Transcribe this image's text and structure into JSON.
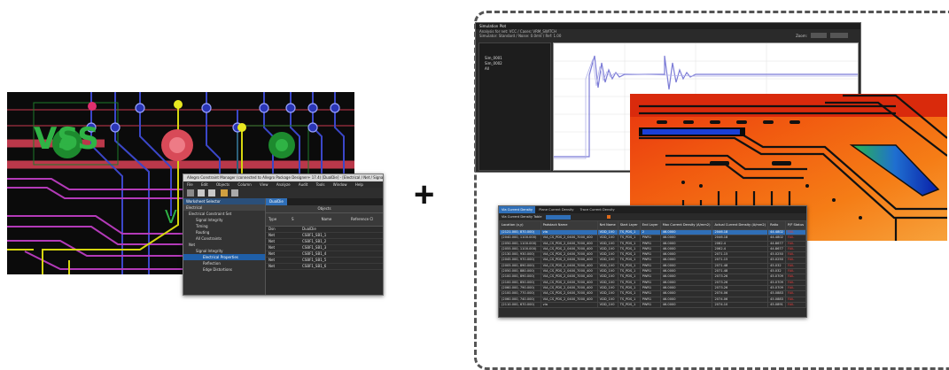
{
  "pcb": {
    "label_vss": "VSS",
    "label_v": "V"
  },
  "constraint_manager": {
    "title": "Allegro Constraint Manager (connected to Allegro Package Designer+ 17.4) [DualDie] - [Electrical / Net / Signal Integrity]",
    "menu": [
      "File",
      "Edit",
      "Objects",
      "Column",
      "View",
      "Analyze",
      "Audit",
      "Tools",
      "Window",
      "Help"
    ],
    "worksheet_selector_label": "Worksheet Selector",
    "section_label": "Electrical",
    "tree": [
      {
        "label": "Electrical Constraint Set",
        "level": 0
      },
      {
        "label": "Signal Integrity",
        "level": 1
      },
      {
        "label": "Timing",
        "level": 1
      },
      {
        "label": "Routing",
        "level": 1
      },
      {
        "label": "All Constraints",
        "level": 1
      },
      {
        "label": "Net",
        "level": 0
      },
      {
        "label": "Signal Integrity",
        "level": 1
      },
      {
        "label": "Electrical Properties",
        "level": 2,
        "selected": true
      },
      {
        "label": "Reflection",
        "level": 2
      },
      {
        "label": "Edge Distortions",
        "level": 2
      }
    ],
    "grid_tab": "DualDie",
    "objects_header": "Objects",
    "col_type": "Type",
    "col_s": "S",
    "col_name": "Name",
    "col_ref": "Reference Cl",
    "rows": [
      {
        "type": "Dsn",
        "name": "DualDie"
      },
      {
        "type": "Net",
        "name": "CSBF1_SB1_1"
      },
      {
        "type": "Net",
        "name": "CSBF1_SB1_2"
      },
      {
        "type": "Net",
        "name": "CSBF1_SB1_3"
      },
      {
        "type": "Net",
        "name": "CSBF1_SB1_4"
      },
      {
        "type": "Net",
        "name": "CSBF1_SB1_5"
      },
      {
        "type": "Net",
        "name": "CSBF1_SB1_6"
      }
    ]
  },
  "plus": "+",
  "simulation_plot": {
    "title": "Simulation Plot",
    "header_line1": "Analysis for net: VCC / Cases: VRM_SWITCH",
    "header_line2": "Simulator: Standard / Noise: 0.0mV / Ref: 1.00",
    "zoom_label": "Zoom:",
    "tree_items": [
      "Sim_0001",
      "Sim_0002",
      "All"
    ],
    "waveform_color": "#7b7bd6"
  },
  "current_density": {
    "tabs": [
      "Via Current Density",
      "Plane Current Density",
      "Trace Current Density"
    ],
    "filter_label": "Via Current Density Table",
    "headers": [
      "Location (x,y)",
      "Padstack Name",
      "Net Name",
      "Start Layer",
      "End Layer",
      "Max Current Density (A/mm2)",
      "Actual Current Density (A/mm2)",
      "Ratio",
      "P/F Status"
    ],
    "rows": [
      [
        "(2121.000, 870.000)",
        "via",
        "VDD_1V0",
        "TS_PDS_1",
        "2",
        "46.0000",
        "2046.18",
        "44.4802",
        "FAIL"
      ],
      [
        "(2040.000, 1100.000)",
        "VIA_CS_PDS_2_0400_7000_400",
        "VDD_1V0",
        "TS_PDS_1",
        "PWR1",
        "46.0000",
        "2046.18",
        "44.4802",
        "FAIL"
      ],
      [
        "(2050.000, 1100.000)",
        "VIA_CS_PDS_2_0400_7000_400",
        "VDD_1V0",
        "TS_PDS_1",
        "PWR1",
        "46.0000",
        "2062.4",
        "44.8677",
        "FAIL"
      ],
      [
        "(2055.000, 1100.000)",
        "VIA_CS_PDS_2_0400_7000_400",
        "VDD_1V0",
        "TS_PDS_1",
        "PWR1",
        "46.0000",
        "2062.4",
        "44.8677",
        "FAIL"
      ],
      [
        "(2130.000, 930.000)",
        "VIA_CS_PDS_2_0400_7000_400",
        "VDD_1V0",
        "TS_PDS_1",
        "PWR1",
        "46.0000",
        "2071.15",
        "45.0250",
        "FAIL"
      ],
      [
        "(2045.000, 970.000)",
        "VIA_CS_PDS_2_0400_7000_400",
        "VDD_1V0",
        "TS_PDS_1",
        "PWR1",
        "46.0000",
        "2071.15",
        "45.0250",
        "FAIL"
      ],
      [
        "(2005.000, 890.000)",
        "VIA_CS_PDS_2_0400_7000_400",
        "VDD_1V0",
        "TS_PDS_1",
        "PWR1",
        "46.0000",
        "2071.48",
        "45.032",
        "FAIL"
      ],
      [
        "(2050.000, 880.000)",
        "VIA_CS_PDS_2_0400_7000_400",
        "VDD_1V0",
        "TS_PDS_1",
        "PWR1",
        "46.0000",
        "2071.48",
        "45.032",
        "FAIL"
      ],
      [
        "(2100.000, 890.000)",
        "VIA_CS_PDS_2_0400_7000_400",
        "VDD_1V0",
        "TS_PDS_1",
        "PWR1",
        "46.0000",
        "2073.26",
        "45.0709",
        "FAIL"
      ],
      [
        "(2100.000, 850.000)",
        "VIA_CS_PDS_2_0400_7000_400",
        "VDD_1V0",
        "TS_PDS_1",
        "PWR1",
        "46.0000",
        "2073.26",
        "45.0709",
        "FAIL"
      ],
      [
        "(2060.000, 790.000)",
        "VIA_CS_PDS_2_0400_7000_400",
        "VDD_1V0",
        "TS_PDS_1",
        "PWR1",
        "46.0000",
        "2073.26",
        "45.0709",
        "FAIL"
      ],
      [
        "(2100.000, 770.000)",
        "VIA_CS_PDS_2_0400_7000_400",
        "VDD_1V0",
        "TS_PDS_1",
        "PWR1",
        "46.0000",
        "2074.06",
        "45.0883",
        "FAIL"
      ],
      [
        "(2060.000, 740.000)",
        "VIA_CS_PDS_2_0400_7000_400",
        "VDD_1V0",
        "TS_PDS_1",
        "PWR1",
        "46.0000",
        "2074.06",
        "45.0883",
        "FAIL"
      ],
      [
        "(2110.000, 670.000)",
        "via",
        "VDD_1V0",
        "TS_PDS_1",
        "PWR1",
        "46.0000",
        "2074.10",
        "45.0891",
        "FAIL"
      ]
    ],
    "fail_color": "#e23b3b"
  }
}
